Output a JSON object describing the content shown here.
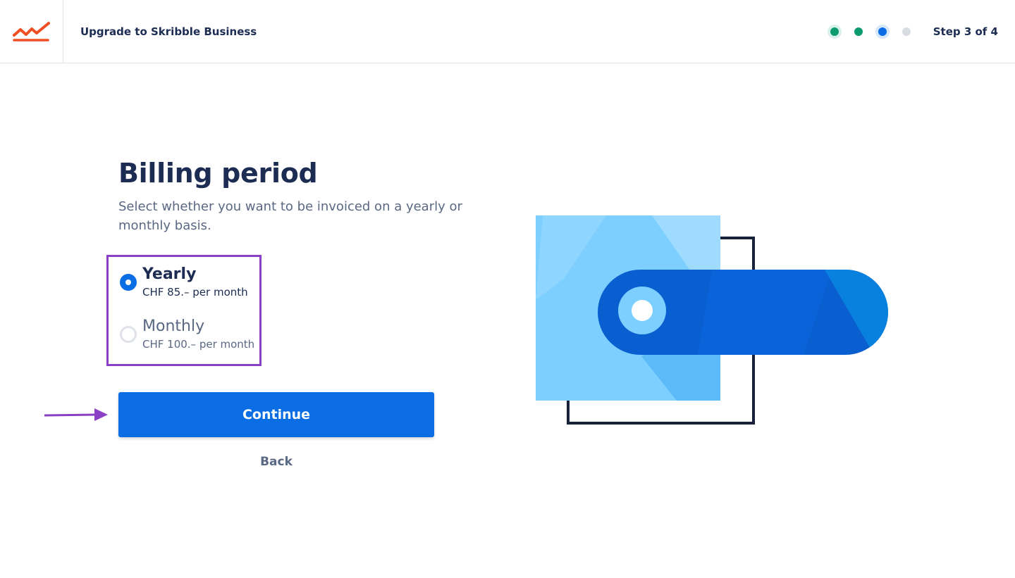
{
  "header": {
    "title": "Upgrade to Skribble Business",
    "logo_icon": "skribble-logo-icon",
    "brand_color": "#f04e23",
    "steps": {
      "total": 4,
      "current": 3,
      "label": "Step 3 of 4",
      "dot_colors": [
        "#0b9b6f",
        "#0b9b6f",
        "#0a6de3",
        "#d8dce3"
      ]
    }
  },
  "main": {
    "title": "Billing period",
    "subtitle": "Select whether you want to be invoiced on a yearly or monthly basis.",
    "options": [
      {
        "name": "Yearly",
        "price": "CHF 85.– per month",
        "selected": true
      },
      {
        "name": "Monthly",
        "price": "CHF 100.– per month",
        "selected": false
      }
    ],
    "continue_label": "Continue",
    "back_label": "Back"
  },
  "colors": {
    "primary": "#0a6de3",
    "annotation": "#8a3fc4",
    "text_dark": "#1c2c52",
    "text_muted": "#5a6883"
  },
  "illustration": {
    "icon": "toggle-switch-illustration"
  }
}
